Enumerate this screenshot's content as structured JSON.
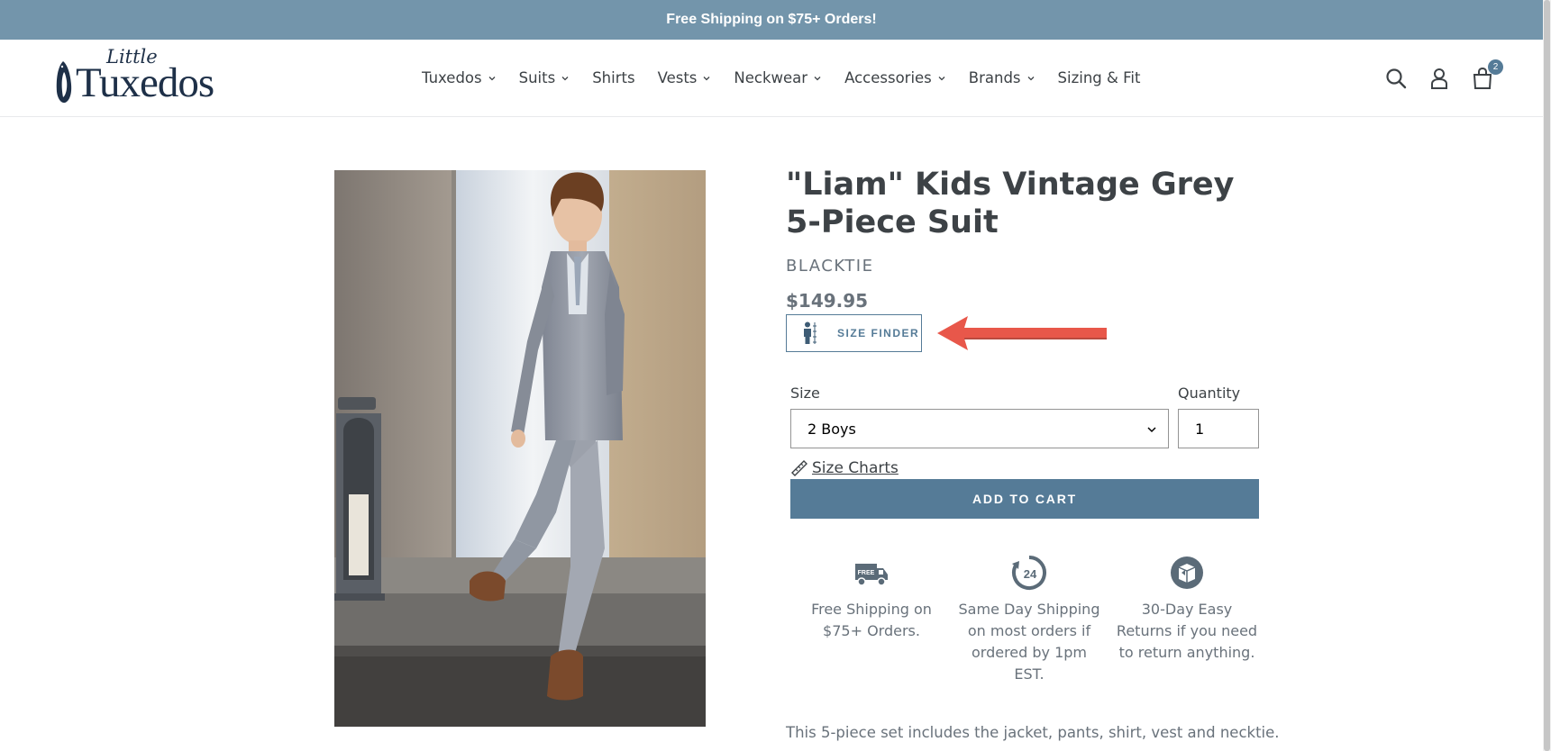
{
  "announcement": "Free Shipping on $75+ Orders!",
  "logo": {
    "small": "Little",
    "main": "Tuxedos"
  },
  "nav": [
    {
      "label": "Tuxedos",
      "dropdown": true
    },
    {
      "label": "Suits",
      "dropdown": true
    },
    {
      "label": "Shirts",
      "dropdown": false
    },
    {
      "label": "Vests",
      "dropdown": true
    },
    {
      "label": "Neckwear",
      "dropdown": true
    },
    {
      "label": "Accessories",
      "dropdown": true
    },
    {
      "label": "Brands",
      "dropdown": true
    },
    {
      "label": "Sizing & Fit",
      "dropdown": false
    }
  ],
  "header_icons": [
    "search-icon",
    "account-icon",
    "cart-icon"
  ],
  "cart_count": "2",
  "product": {
    "title": "\"Liam\" Kids Vintage Grey 5-Piece Suit",
    "vendor": "BLACKTIE",
    "price": "$149.95",
    "size_finder": "SIZE FINDER",
    "size_label": "Size",
    "size_value": "2 Boys",
    "quantity_label": "Quantity",
    "quantity_value": "1",
    "size_charts": "Size Charts",
    "add_to_cart": "ADD TO CART",
    "description": "This 5-piece set includes the jacket, pants, shirt, vest and necktie."
  },
  "features": [
    {
      "icon": "free-shipping-truck-icon",
      "text": "Free Shipping on $75+ Orders."
    },
    {
      "icon": "24-hour-icon",
      "text": "Same Day Shipping on most orders if ordered by 1pm EST."
    },
    {
      "icon": "returns-box-icon",
      "text": "30-Day Easy Returns if you need to return anything."
    }
  ],
  "colors": {
    "announcement_bg": "#7395ab",
    "accent": "#557b97",
    "arrow": "#e8574a",
    "text": "#3d4246"
  }
}
